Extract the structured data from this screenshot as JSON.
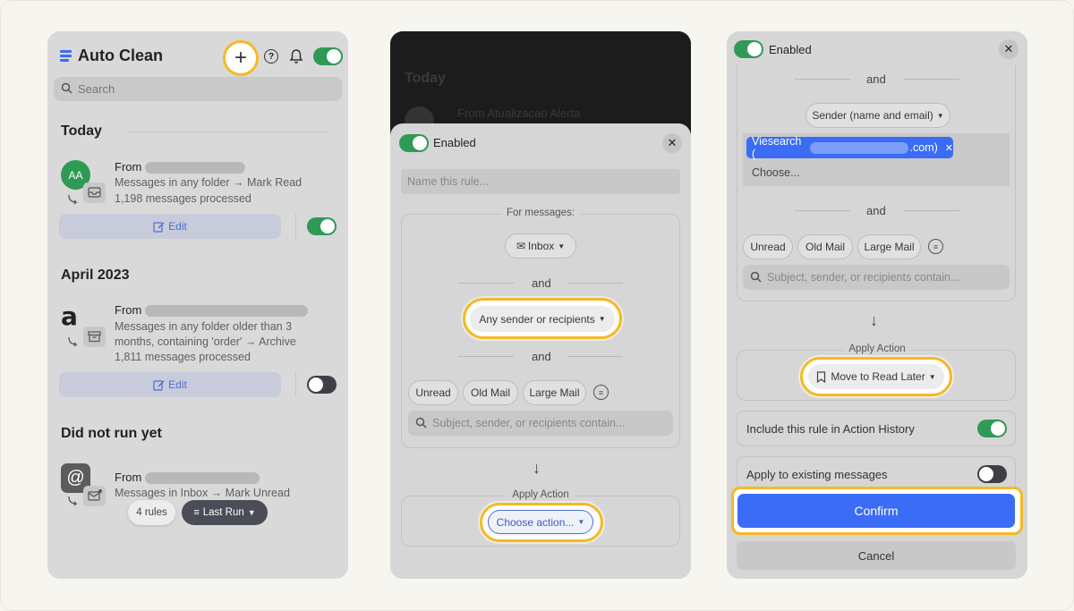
{
  "panel1": {
    "title": "Auto Clean",
    "search_placeholder": "Search",
    "sections": [
      {
        "heading": "Today"
      },
      {
        "heading": "April 2023"
      },
      {
        "heading": "Did not run yet"
      }
    ],
    "rules": [
      {
        "avatar_text": "AA",
        "from_label": "From",
        "description": "Messages in any folder → Mark Read",
        "processed": "1,198 messages processed",
        "edit_label": "Edit",
        "enabled": true
      },
      {
        "avatar_text": "a",
        "from_label": "From",
        "description": "Messages in any folder  older than 3 months, containing 'order' → Archive",
        "processed": "1,811 messages processed",
        "edit_label": "Edit",
        "enabled": false
      },
      {
        "avatar_text": "@",
        "from_label": "From",
        "description": "Messages in Inbox → Mark Unread"
      }
    ],
    "rules_count": "4 rules",
    "sort_label": "Last Run"
  },
  "panel2": {
    "background_heading": "Today",
    "background_from": "From Atualizacao Alerta",
    "enabled_label": "Enabled",
    "name_placeholder": "Name this rule...",
    "for_messages_label": "For messages:",
    "folder_label": "Inbox",
    "and_label": "and",
    "sender_label": "Any sender or recipients",
    "filters": [
      "Unread",
      "Old Mail",
      "Large Mail"
    ],
    "search_placeholder": "Subject, sender, or recipients contain...",
    "apply_action_label": "Apply Action",
    "choose_action_label": "Choose action..."
  },
  "panel3": {
    "enabled_label": "Enabled",
    "and_label": "and",
    "sender_label": "Sender (name and email)",
    "sender_tag_prefix": "Viesearch (",
    "sender_tag_suffix": ".com)",
    "choose_label": "Choose...",
    "filters": [
      "Unread",
      "Old Mail",
      "Large Mail"
    ],
    "search_placeholder": "Subject, sender, or recipients contain...",
    "apply_action_label": "Apply Action",
    "action_label": "Move to Read Later",
    "include_history_label": "Include this rule in Action History",
    "apply_existing_label": "Apply to existing messages",
    "confirm_label": "Confirm",
    "cancel_label": "Cancel"
  },
  "colors": {
    "accent": "#f5b924",
    "primary": "#3b6cf6",
    "toggle_on": "#2f9a55",
    "edit_blue": "#4a6fd0"
  }
}
